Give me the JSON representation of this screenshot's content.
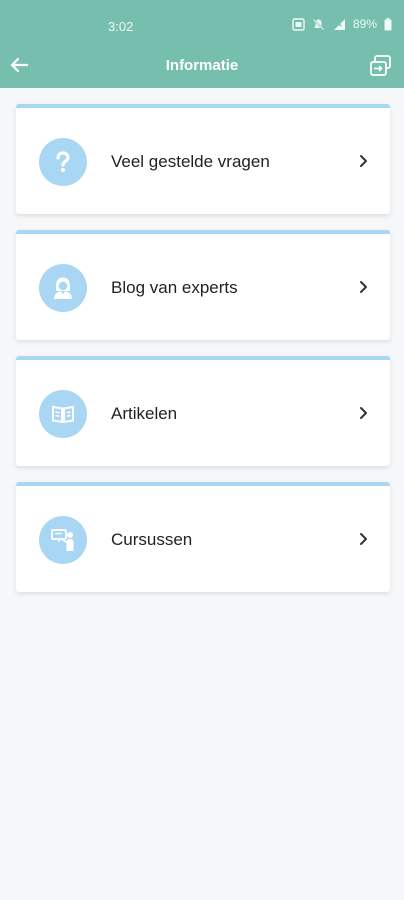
{
  "status_bar": {
    "time": "3:02",
    "battery": "89%",
    "icons": [
      "sim-icon",
      "mute-icon",
      "signal-icon",
      "battery-icon"
    ]
  },
  "header": {
    "title": "Informatie",
    "back_icon": "arrow-left-icon",
    "action_icon": "switch-profile-icon",
    "color": "#76bfae"
  },
  "menu": {
    "accent_color": "#a9d6f2",
    "items": [
      {
        "label": "Veel gestelde vragen",
        "icon": "question-mark-icon"
      },
      {
        "label": "Blog van experts",
        "icon": "expert-avatar-icon"
      },
      {
        "label": "Artikelen",
        "icon": "book-icon"
      },
      {
        "label": "Cursussen",
        "icon": "course-presenter-icon"
      }
    ]
  }
}
